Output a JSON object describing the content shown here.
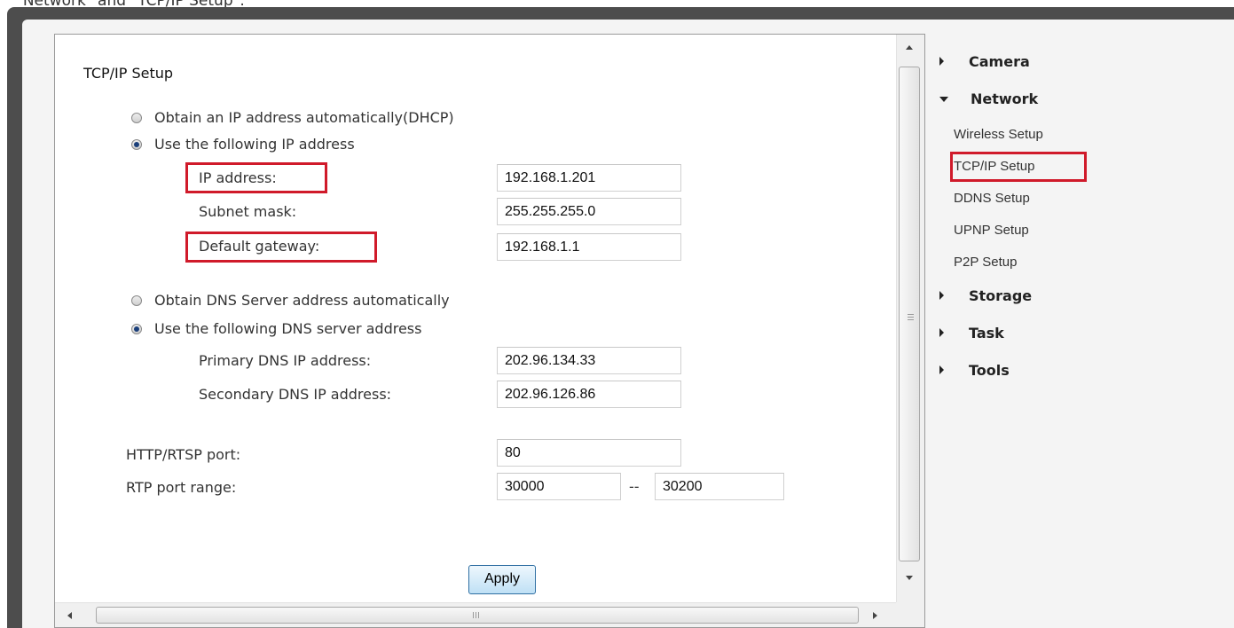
{
  "caption": "\"Network\" and \"TCP/IP Setup\".",
  "form": {
    "title": "TCP/IP Setup",
    "ip_mode": {
      "auto_label": "Obtain an IP address automatically(DHCP)",
      "manual_label": "Use the following IP address",
      "selected": "manual"
    },
    "ip_address": {
      "label": "IP address:",
      "value": "192.168.1.201"
    },
    "subnet_mask": {
      "label": "Subnet mask:",
      "value": "255.255.255.0"
    },
    "default_gateway": {
      "label": "Default gateway:",
      "value": "192.168.1.1"
    },
    "dns_mode": {
      "auto_label": "Obtain DNS Server address automatically",
      "manual_label": "Use the following DNS server address",
      "selected": "manual"
    },
    "primary_dns": {
      "label": "Primary DNS IP address:",
      "value": "202.96.134.33"
    },
    "secondary_dns": {
      "label": "Secondary DNS IP address:",
      "value": "202.96.126.86"
    },
    "http_port": {
      "label": "HTTP/RTSP port:",
      "value": "80"
    },
    "rtp_range": {
      "label": "RTP port range:",
      "from": "30000",
      "separator": "--",
      "to": "30200"
    },
    "apply_label": "Apply"
  },
  "sidebar": {
    "camera": "Camera",
    "network": "Network",
    "network_items": [
      "Wireless Setup",
      "TCP/IP Setup",
      "DDNS Setup",
      "UPNP Setup",
      "P2P Setup"
    ],
    "storage": "Storage",
    "task": "Task",
    "tools": "Tools",
    "active_item": "TCP/IP Setup"
  },
  "colors": {
    "highlight": "#d01a2a",
    "frame": "#4d4d4d",
    "apply_border": "#2f6fa3"
  }
}
